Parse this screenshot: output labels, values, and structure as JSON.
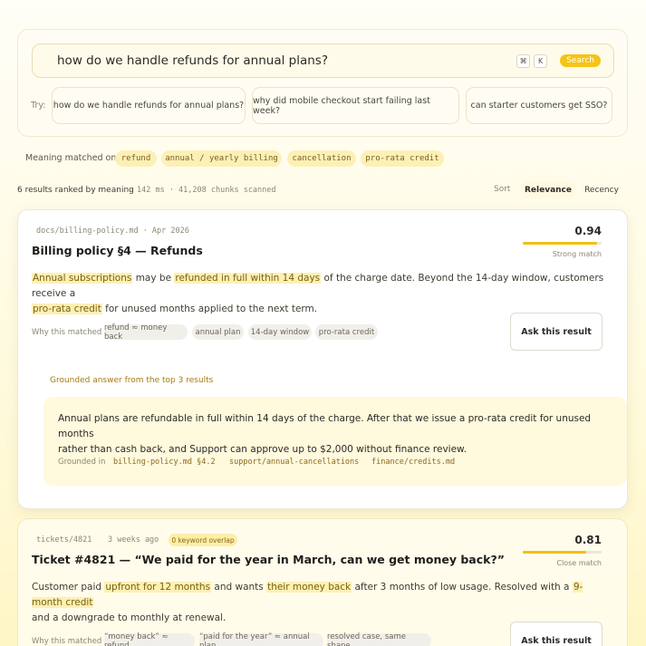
{
  "search": {
    "query": "how do we handle refunds for annual plans?",
    "kbd_cmd": "⌘",
    "kbd_k": "K",
    "button": "Search",
    "try_label": "Try:",
    "suggestions": [
      "how do we handle refunds for annual plans?",
      "why did mobile checkout start failing last week?",
      "can starter customers get SSO?"
    ]
  },
  "meaning": {
    "label": "Meaning matched on",
    "chips": [
      "refund",
      "annual / yearly billing",
      "cancellation",
      "pro-rata credit"
    ]
  },
  "results_header": {
    "count": "6 results ranked by meaning",
    "meta": "142 ms · 41,208 chunks scanned",
    "sort_label": "Sort",
    "sort_options": [
      "Relevance",
      "Recency"
    ],
    "active_sort": "Relevance"
  },
  "results": [
    {
      "source": "docs/billing-policy.md · Apr 2026",
      "title": "Billing policy §4 — Refunds",
      "score": "0.94",
      "score_fraction": 0.94,
      "score_label": "Strong match",
      "snippet": {
        "h1": "Annual subscriptions",
        "t1": " may be ",
        "h2": "refunded in full within 14 days",
        "t2": " of the charge date. Beyond the 14-day window, customers receive a",
        "h3": "pro-rata credit",
        "t3": " for unused months applied to the next term."
      },
      "why_label": "Why this matched",
      "tags": [
        "refund ≈ money back",
        "annual plan",
        "14-day window",
        "pro-rata credit"
      ],
      "ask_button": "Ask this result",
      "grounded": {
        "title": "Grounded answer from the top 3 results",
        "answer_line1": "Annual plans are refundable in full within 14 days of the charge. After that we issue a pro-rata credit for unused months",
        "answer_line2": "rather than cash back, and Support can approve up to $2,000 without finance review.",
        "label": "Grounded in",
        "sources": [
          "billing-policy.md §4.2",
          "support/annual-cancellations",
          "finance/credits.md"
        ]
      }
    },
    {
      "source_id": "tickets/4821",
      "age": "3 weeks ago",
      "badge": "0 keyword overlap",
      "title": "Ticket #4821 — “We paid for the year in March, can we get money back?”",
      "score": "0.81",
      "score_fraction": 0.81,
      "score_label": "Close match",
      "snippet": {
        "t0": "Customer paid ",
        "h1": "upfront for 12 months",
        "t1": " and wants ",
        "h2": "their money back",
        "t2": " after 3 months of low usage. Resolved with a ",
        "h3": "9-month credit",
        "t3": "and a downgrade to monthly at renewal."
      },
      "why_label": "Why this matched",
      "tags": [
        "“money back” ≈ refund",
        "“paid for the year” ≈ annual plan",
        "resolved case, same shape"
      ],
      "ask_button": "Ask this result"
    }
  ],
  "colors": {
    "accent": "#f5c418",
    "highlight_bg": "#fdf0b3",
    "chip_bg": "#fdf0b6"
  }
}
